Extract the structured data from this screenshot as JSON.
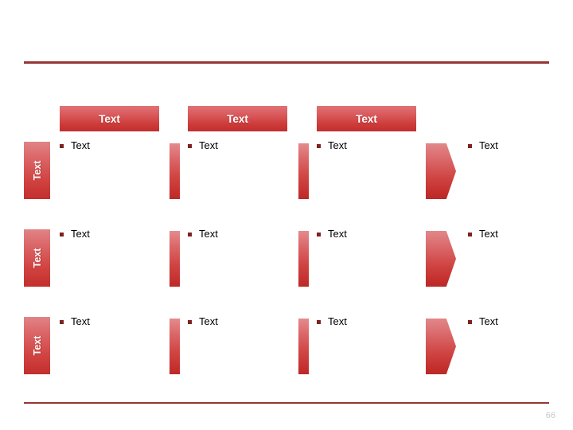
{
  "slide": {
    "page_number": "66",
    "colors": {
      "rule": "#963634",
      "chip_top": "#df7376",
      "chip_bottom": "#c0302e",
      "bullet": "#7f2220",
      "page_number": "#c8c8c8",
      "header_text": "#ffffff",
      "body_text": "#000000"
    }
  },
  "column_headers": [
    {
      "label": "Text"
    },
    {
      "label": "Text"
    },
    {
      "label": "Text"
    }
  ],
  "row_labels": [
    {
      "label": "Text"
    },
    {
      "label": "Text"
    },
    {
      "label": "Text"
    }
  ],
  "rows": [
    {
      "cells": [
        {
          "label": "Text"
        },
        {
          "label": "Text"
        },
        {
          "label": "Text"
        },
        {
          "label": "Text"
        }
      ]
    },
    {
      "cells": [
        {
          "label": "Text"
        },
        {
          "label": "Text"
        },
        {
          "label": "Text"
        },
        {
          "label": "Text"
        }
      ]
    },
    {
      "cells": [
        {
          "label": "Text"
        },
        {
          "label": "Text"
        },
        {
          "label": "Text"
        },
        {
          "label": "Text"
        }
      ]
    }
  ]
}
